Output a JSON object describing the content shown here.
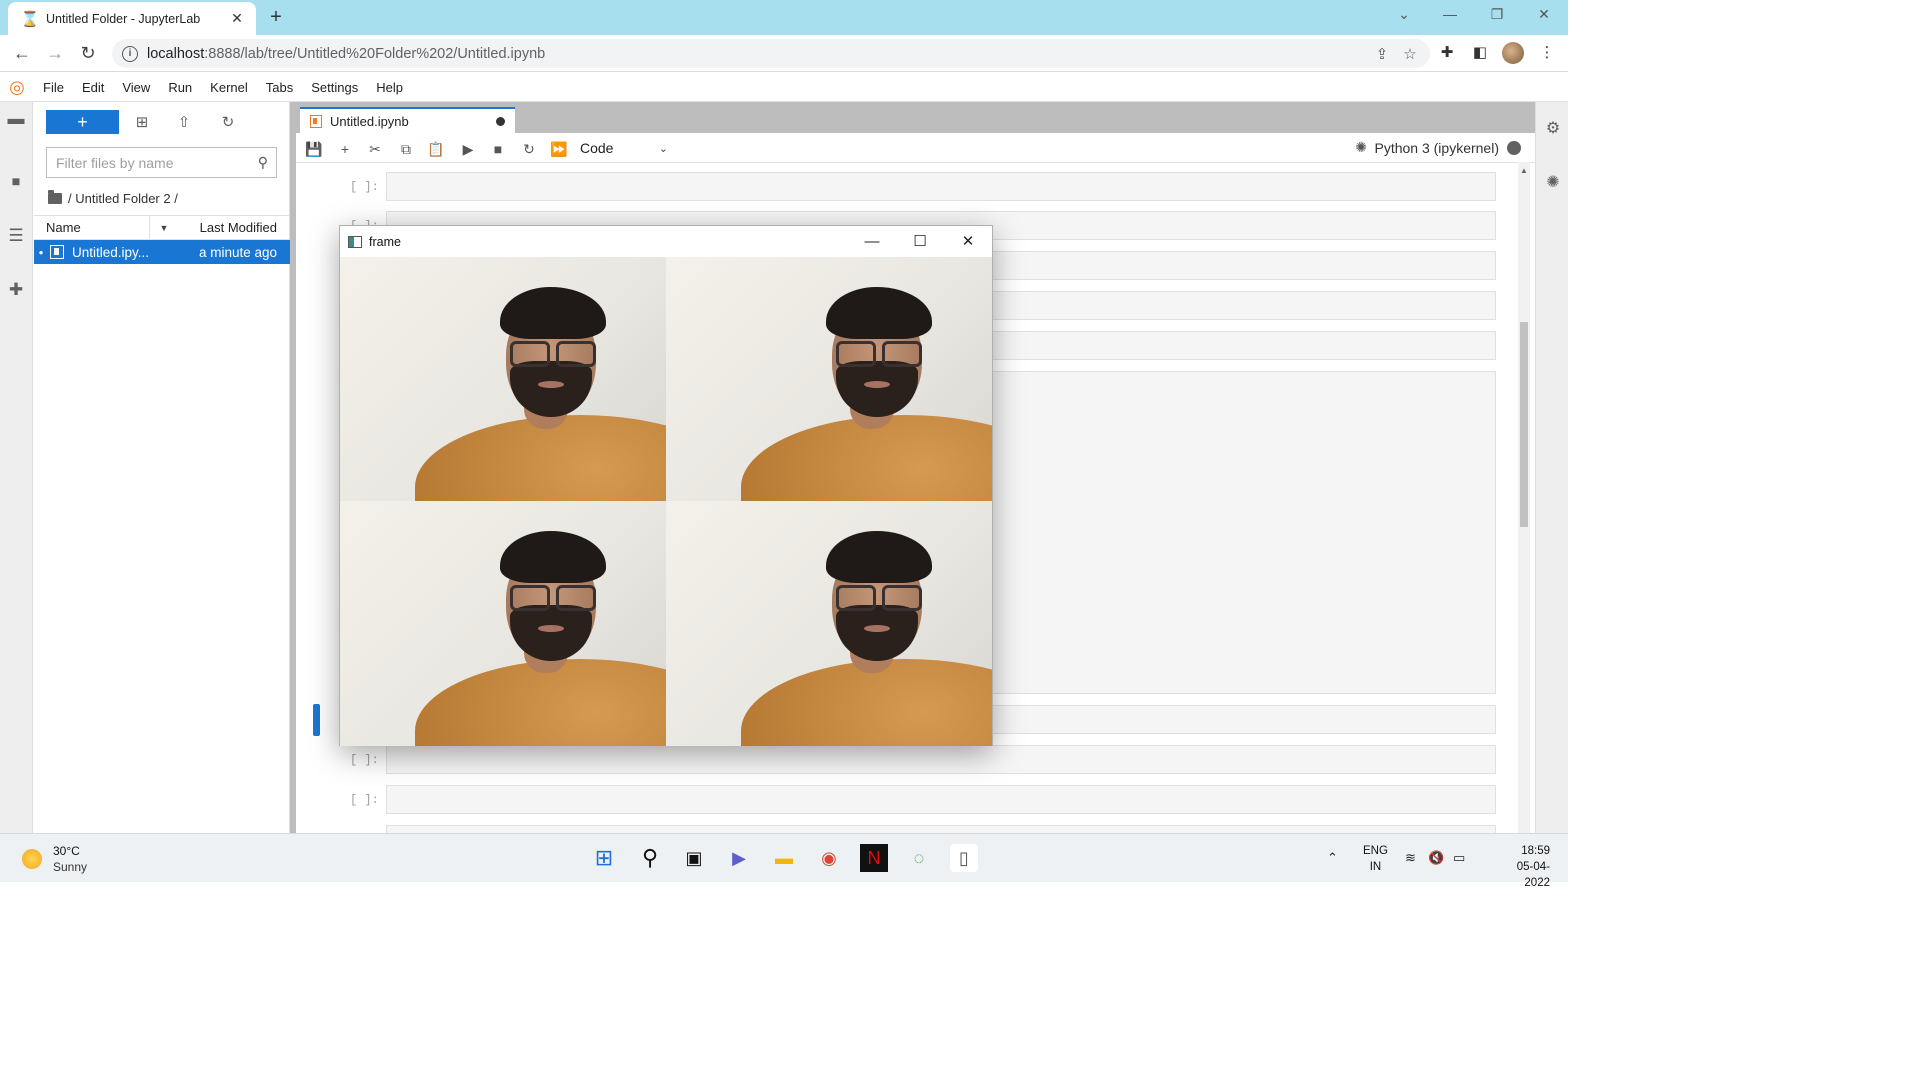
{
  "browser": {
    "tab_title": "Untitled Folder - JupyterLab",
    "url_host": "localhost",
    "url_rest": ":8888/lab/tree/Untitled%20Folder%202/Untitled.ipynb"
  },
  "menubar": {
    "items": [
      "File",
      "Edit",
      "View",
      "Run",
      "Kernel",
      "Tabs",
      "Settings",
      "Help"
    ]
  },
  "filebrowser": {
    "new_label": "+",
    "filter_placeholder": "Filter files by name",
    "breadcrumb": "/ Untitled Folder 2 /",
    "col_name": "Name",
    "col_modified": "Last Modified",
    "files": [
      {
        "name": "Untitled.ipy...",
        "modified": "a minute ago",
        "selected": true
      }
    ]
  },
  "notebook": {
    "tab_label": "Untitled.ipynb",
    "cell_type": "Code",
    "kernel_name": "Python 3 (ipykernel)",
    "prompt_empty": "[ ]:"
  },
  "cv_window": {
    "title": "frame"
  },
  "taskbar": {
    "temperature": "30°C",
    "condition": "Sunny",
    "lang_top": "ENG",
    "lang_bottom": "IN",
    "time": "18:59",
    "date": "05-04-2022"
  },
  "colors": {
    "jupyter_blue": "#1976d2",
    "jupyter_orange": "#f37726",
    "chrome_tabstrip": "#a8dfee",
    "shirt": "#c98a42"
  }
}
